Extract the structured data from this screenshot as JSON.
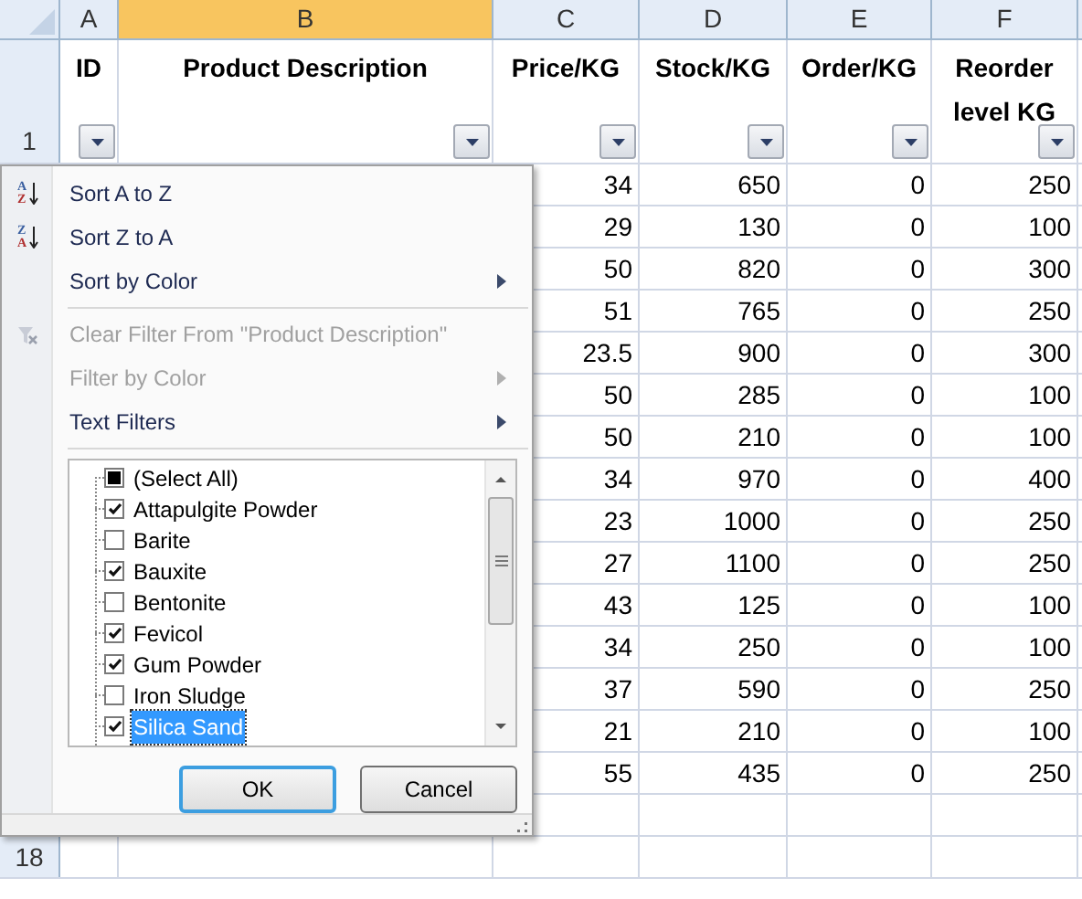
{
  "columns": [
    {
      "letter": "A",
      "title": "ID",
      "selected": false
    },
    {
      "letter": "B",
      "title": "Product Description",
      "selected": true
    },
    {
      "letter": "C",
      "title": "Price/KG",
      "selected": false
    },
    {
      "letter": "D",
      "title": "Stock/KG",
      "selected": false
    },
    {
      "letter": "E",
      "title": "Order/KG",
      "selected": false
    },
    {
      "letter": "F",
      "title": "Reorder level KG",
      "selected": false
    }
  ],
  "header_row_number": "1",
  "rows": [
    [
      "34",
      "650",
      "0",
      "250"
    ],
    [
      "29",
      "130",
      "0",
      "100"
    ],
    [
      "50",
      "820",
      "0",
      "300"
    ],
    [
      "51",
      "765",
      "0",
      "250"
    ],
    [
      "23.5",
      "900",
      "0",
      "300"
    ],
    [
      "50",
      "285",
      "0",
      "100"
    ],
    [
      "50",
      "210",
      "0",
      "100"
    ],
    [
      "34",
      "970",
      "0",
      "400"
    ],
    [
      "23",
      "1000",
      "0",
      "250"
    ],
    [
      "27",
      "1100",
      "0",
      "250"
    ],
    [
      "43",
      "125",
      "0",
      "100"
    ],
    [
      "34",
      "250",
      "0",
      "100"
    ],
    [
      "37",
      "590",
      "0",
      "250"
    ],
    [
      "21",
      "210",
      "0",
      "100"
    ],
    [
      "55",
      "435",
      "0",
      "250"
    ]
  ],
  "last_row_number": "18",
  "filter_menu": {
    "items": [
      {
        "kind": "sort",
        "label": "Sort A to Z",
        "icon_top": "A",
        "icon_bottom": "Z",
        "disabled": false,
        "submenu": false
      },
      {
        "kind": "sort",
        "label": "Sort Z to A",
        "icon_top": "Z",
        "icon_bottom": "A",
        "disabled": false,
        "submenu": false
      },
      {
        "kind": "plain",
        "label": "Sort by Color",
        "disabled": false,
        "submenu": true
      },
      {
        "kind": "separator"
      },
      {
        "kind": "clear",
        "label": "Clear Filter From \"Product Description\"",
        "disabled": true,
        "submenu": false
      },
      {
        "kind": "plain",
        "label": "Filter by Color",
        "disabled": true,
        "submenu": true
      },
      {
        "kind": "plain",
        "label": "Text Filters",
        "disabled": false,
        "submenu": true
      },
      {
        "kind": "separator"
      }
    ],
    "select_all": {
      "label": "(Select All)",
      "partial": true
    },
    "values": [
      {
        "label": "Attapulgite Powder",
        "checked": true,
        "selected": false
      },
      {
        "label": "Barite",
        "checked": false,
        "selected": false
      },
      {
        "label": "Bauxite",
        "checked": true,
        "selected": false
      },
      {
        "label": "Bentonite",
        "checked": false,
        "selected": false
      },
      {
        "label": "Fevicol",
        "checked": true,
        "selected": false
      },
      {
        "label": "Gum Powder",
        "checked": true,
        "selected": false
      },
      {
        "label": "Iron Sludge",
        "checked": false,
        "selected": false
      },
      {
        "label": "Silica Sand",
        "checked": true,
        "selected": true
      }
    ],
    "buttons": [
      {
        "label": "OK",
        "default": true
      },
      {
        "label": "Cancel",
        "default": false
      }
    ]
  }
}
